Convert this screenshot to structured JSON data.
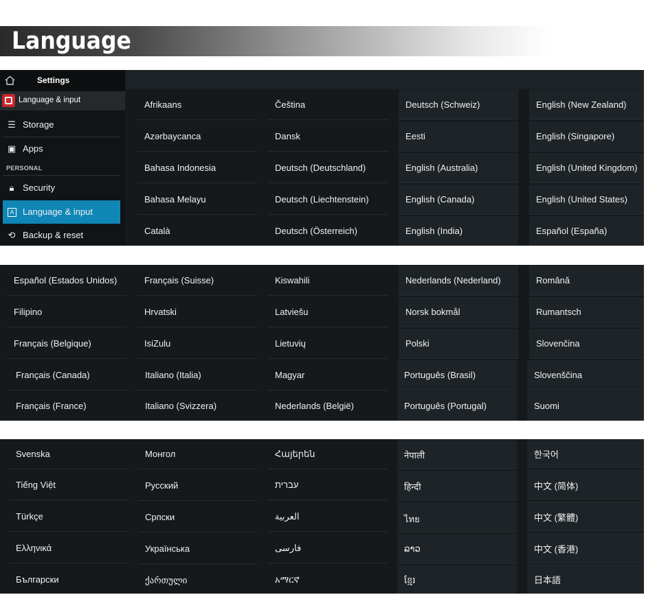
{
  "banner": {
    "title": "Language"
  },
  "sidebar": {
    "header_title": "Settings",
    "sub_title": "Language & input",
    "section_personal": "PERSONAL",
    "items": [
      {
        "label": "Storage",
        "icon": "storage-icon"
      },
      {
        "label": "Apps",
        "icon": "apps-icon"
      },
      {
        "label": "Security",
        "icon": "lock-icon"
      },
      {
        "label": "Language & input",
        "icon": "language-icon"
      },
      {
        "label": "Backup & reset",
        "icon": "backup-icon"
      }
    ],
    "active_color": "#0f86b5"
  },
  "panel1": {
    "columns": [
      [
        "Afrikaans",
        "Azərbaycanca",
        "Bahasa Indonesia",
        "Bahasa Melayu",
        "Català"
      ],
      [
        "Čeština",
        "Dansk",
        "Deutsch (Deutschland)",
        "Deutsch (Liechtenstein)",
        "Deutsch (Österreich)"
      ],
      [
        "Deutsch (Schweiz)",
        "Eesti",
        "English (Australia)",
        "English (Canada)",
        "English (India)"
      ],
      [
        "English (New Zealand)",
        "English (Singapore)",
        "English (United Kingdom)",
        "English (United States)",
        "Español (España)"
      ]
    ]
  },
  "panel2": {
    "columns": [
      [
        "Español (Estados Unidos)",
        "Filipino",
        "Français (Belgique)",
        "Français (Canada)",
        "Français (France)"
      ],
      [
        "Français (Suisse)",
        "Hrvatski",
        "IsiZulu",
        "Italiano (Italia)",
        "Italiano (Svizzera)"
      ],
      [
        "Kiswahili",
        "Latviešu",
        "Lietuvių",
        "Magyar",
        "Nederlands (België)"
      ],
      [
        "Nederlands (Nederland)",
        "Norsk bokmål",
        "Polski",
        "Português (Brasil)",
        "Português (Portugal)"
      ],
      [
        "Română",
        "Rumantsch",
        "Slovenčina",
        "Slovenščina",
        "Suomi"
      ]
    ]
  },
  "panel3": {
    "columns": [
      [
        "Svenska",
        "Tiếng Việt",
        "Türkçe",
        "Ελληνικά",
        "Български"
      ],
      [
        "Монгол",
        "Русский",
        "Српски",
        "Українська",
        "ქართული"
      ],
      [
        "Հայերեն",
        "עברית",
        "العربية",
        "فارسی",
        "አማርኛ"
      ],
      [
        "नेपाली",
        "हिन्दी",
        "ไทย",
        "ລາວ",
        "ខ្មែរ"
      ],
      [
        "한국어",
        "中文 (简体)",
        "中文 (繁體)",
        "中文 (香港)",
        "日本語"
      ]
    ]
  }
}
